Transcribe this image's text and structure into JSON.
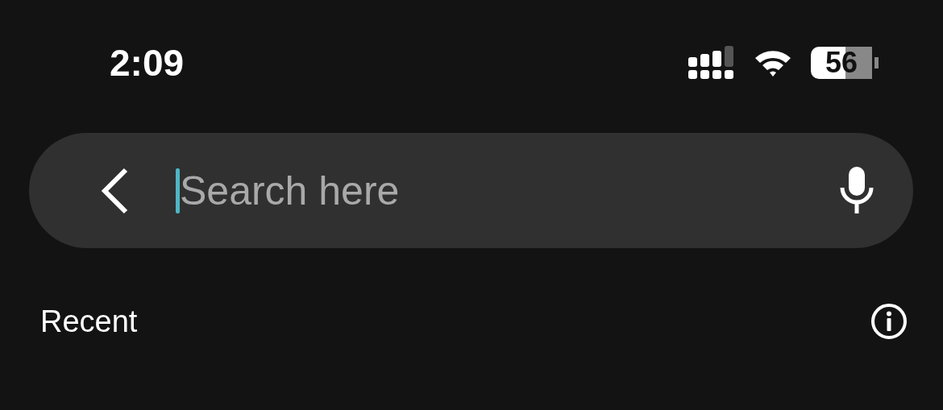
{
  "status_bar": {
    "time": "2:09",
    "battery": "56"
  },
  "search": {
    "placeholder": "Search here"
  },
  "section": {
    "title": "Recent"
  }
}
